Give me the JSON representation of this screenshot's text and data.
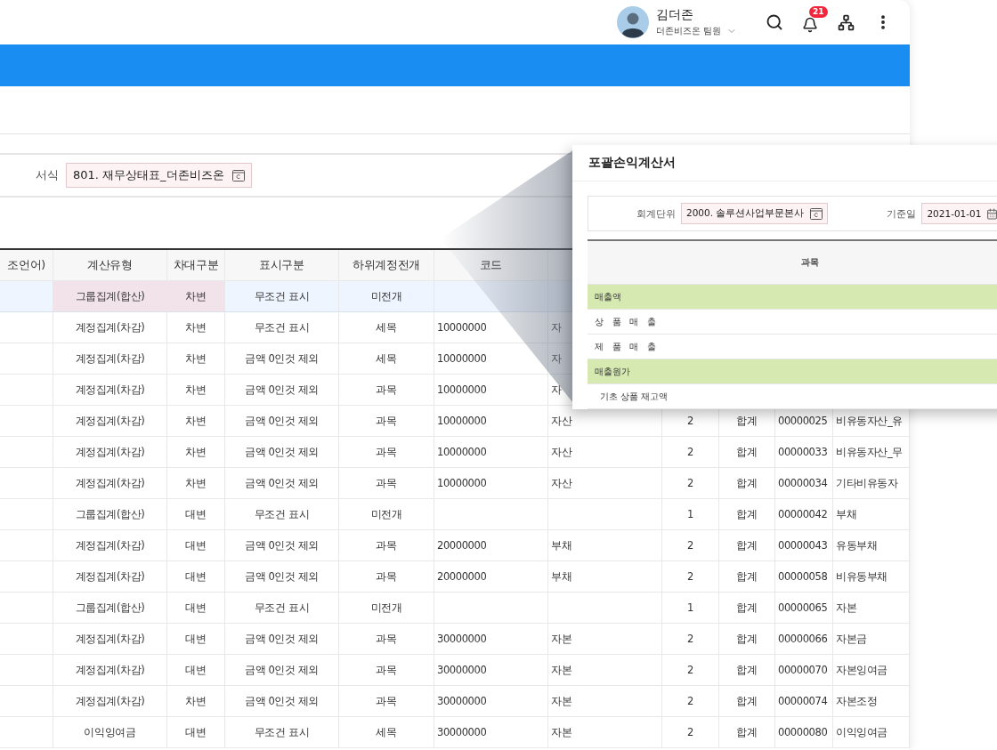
{
  "header": {
    "user_name": "김더존",
    "user_role": "더존비즈온 팀원",
    "notification_count": "21"
  },
  "form": {
    "label": "서식",
    "value": "801. 재무상태표_더존비즈온"
  },
  "table": {
    "columns": [
      {
        "label": "조언어)",
        "required": false
      },
      {
        "label": "계산유형",
        "required": true
      },
      {
        "label": "차대구분",
        "required": true
      },
      {
        "label": "표시구분",
        "required": false
      },
      {
        "label": "하위계정전개",
        "required": false
      },
      {
        "label": "코드",
        "required": false
      }
    ],
    "rows": [
      {
        "selected": true,
        "cells": [
          null,
          "그룹집계(합산)",
          "차변",
          "무조건 표시",
          "미전개",
          null
        ]
      },
      {
        "selected": false,
        "cells": [
          null,
          "계정집계(차감)",
          "차변",
          "무조건 표시",
          "세목",
          "10000000",
          "자"
        ]
      },
      {
        "selected": false,
        "cells": [
          null,
          "계정집계(차감)",
          "차변",
          "금액 0인것 제외",
          "세목",
          "10000000",
          "자"
        ]
      },
      {
        "selected": false,
        "cells": [
          null,
          "계정집계(차감)",
          "차변",
          "금액 0인것 제외",
          "과목",
          "10000000",
          "자"
        ]
      },
      {
        "selected": false,
        "cells": [
          null,
          "계정집계(차감)",
          "차변",
          "금액 0인것 제외",
          "과목",
          "10000000",
          "자산",
          "2",
          "합계",
          "00000025",
          "비유동자산_유"
        ]
      },
      {
        "selected": false,
        "cells": [
          null,
          "계정집계(차감)",
          "차변",
          "금액 0인것 제외",
          "과목",
          "10000000",
          "자산",
          "2",
          "합계",
          "00000033",
          "비유동자산_무"
        ]
      },
      {
        "selected": false,
        "cells": [
          null,
          "계정집계(차감)",
          "차변",
          "금액 0인것 제외",
          "과목",
          "10000000",
          "자산",
          "2",
          "합계",
          "00000034",
          "기타비유동자"
        ]
      },
      {
        "selected": false,
        "cells": [
          null,
          "그룹집계(합산)",
          "대변",
          "무조건 표시",
          "미전개",
          null,
          null,
          "1",
          "합계",
          "00000042",
          "부채"
        ]
      },
      {
        "selected": false,
        "cells": [
          null,
          "계정집계(차감)",
          "대변",
          "금액 0인것 제외",
          "과목",
          "20000000",
          "부채",
          "2",
          "합계",
          "00000043",
          "유동부채"
        ]
      },
      {
        "selected": false,
        "cells": [
          null,
          "계정집계(차감)",
          "대변",
          "금액 0인것 제외",
          "과목",
          "20000000",
          "부채",
          "2",
          "합계",
          "00000058",
          "비유동부채"
        ]
      },
      {
        "selected": false,
        "cells": [
          null,
          "그룹집계(합산)",
          "대변",
          "무조건 표시",
          "미전개",
          null,
          null,
          "1",
          "합계",
          "00000065",
          "자본"
        ]
      },
      {
        "selected": false,
        "cells": [
          null,
          "계정집계(차감)",
          "대변",
          "금액 0인것 제외",
          "과목",
          "30000000",
          "자본",
          "2",
          "합계",
          "00000066",
          "자본금"
        ]
      },
      {
        "selected": false,
        "cells": [
          null,
          "계정집계(차감)",
          "대변",
          "금액 0인것 제외",
          "과목",
          "30000000",
          "자본",
          "2",
          "합계",
          "00000070",
          "자본잉여금"
        ]
      },
      {
        "selected": false,
        "cells": [
          null,
          "계정집계(차감)",
          "차변",
          "금액 0인것 제외",
          "과목",
          "30000000",
          "자본",
          "2",
          "합계",
          "00000074",
          "자본조정"
        ]
      },
      {
        "selected": false,
        "cells": [
          null,
          "이익잉여금",
          "대변",
          "무조건 표시",
          "세목",
          "30000000",
          "자본",
          "2",
          "합계",
          "00000080",
          "이익잉여금"
        ]
      }
    ]
  },
  "popup": {
    "title": "포괄손익계산서",
    "fields": [
      {
        "label": "회계단위",
        "value": "2000. 솔루션사업부문본사",
        "kind": "code"
      },
      {
        "label": "기준일",
        "value": "2021-01-01",
        "kind": "date"
      }
    ],
    "column": "과목",
    "rows": [
      {
        "kind": "group",
        "label": "매출액"
      },
      {
        "kind": "item",
        "label": "상   품   매   출"
      },
      {
        "kind": "item",
        "label": "제   품   매   출"
      },
      {
        "kind": "group",
        "label": "매출원가"
      },
      {
        "kind": "subitem",
        "label": "기초 상품 재고액"
      }
    ]
  }
}
